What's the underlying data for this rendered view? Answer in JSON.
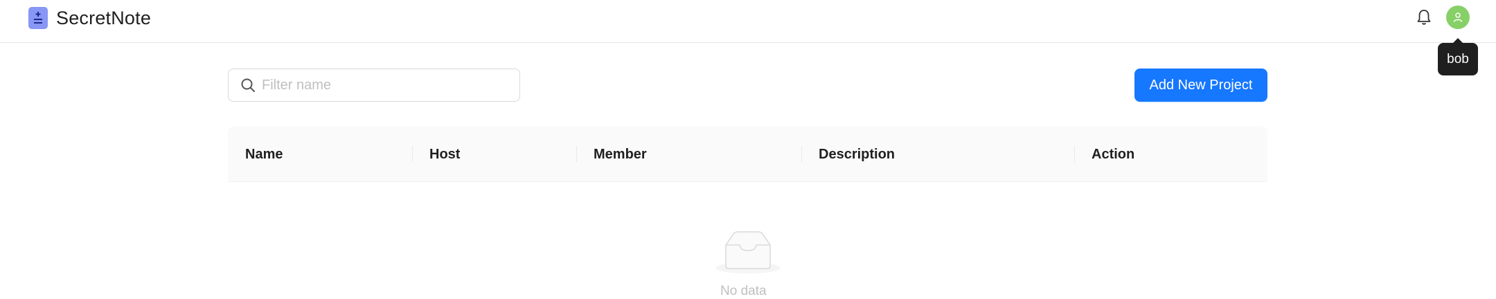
{
  "app": {
    "title": "SecretNote"
  },
  "user": {
    "name": "bob"
  },
  "toolbar": {
    "search_placeholder": "Filter name",
    "add_label": "Add New Project"
  },
  "table": {
    "columns": [
      "Name",
      "Host",
      "Member",
      "Description",
      "Action"
    ],
    "rows": [],
    "empty_text": "No data"
  },
  "colors": {
    "primary": "#1677ff",
    "avatar": "#87d068",
    "logo": "#8896f5"
  },
  "icons": [
    "logo-icon",
    "bell-icon",
    "user-icon",
    "search-icon",
    "empty-inbox-icon"
  ]
}
